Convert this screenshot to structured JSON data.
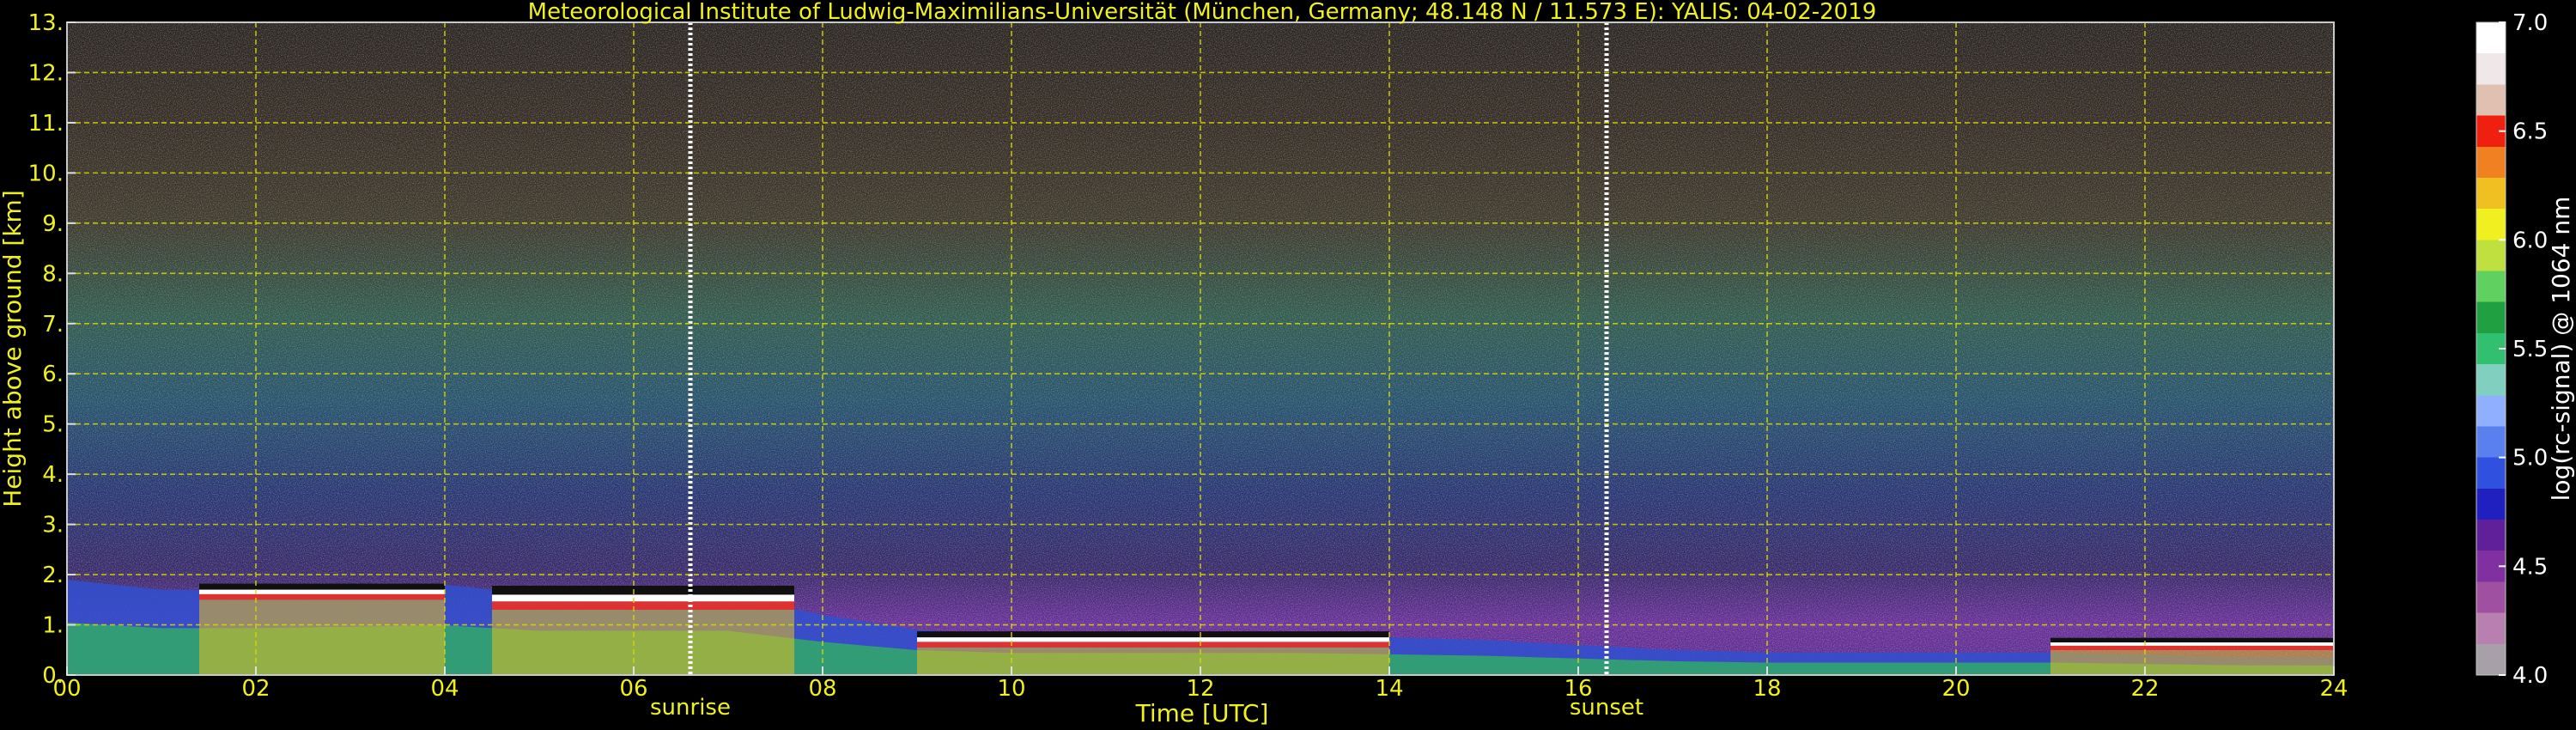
{
  "chart_data": {
    "type": "heatmap",
    "title": "Meteorological Institute of Ludwig-Maximilians-Universität (München, Germany; 48.148 N / 11.573 E):    YALIS: 04-02-2019",
    "xlabel": "Time [UTC]",
    "ylabel": "Height above ground [km]",
    "xlim": [
      0,
      24
    ],
    "ylim": [
      0,
      13
    ],
    "x_ticks": [
      0,
      2,
      4,
      6,
      8,
      10,
      12,
      14,
      16,
      18,
      20,
      22,
      24
    ],
    "x_tick_labels": [
      "00",
      "02",
      "04",
      "06",
      "08",
      "10",
      "12",
      "14",
      "16",
      "18",
      "20",
      "22",
      "24"
    ],
    "y_ticks": [
      0,
      1,
      2,
      3,
      4,
      5,
      6,
      7,
      8,
      9,
      10,
      11,
      12,
      13
    ],
    "y_tick_labels": [
      "0.",
      "1.",
      "2.",
      "3.",
      "4.",
      "5.",
      "6.",
      "7.",
      "8.",
      "9.",
      "10.",
      "11.",
      "12.",
      "13."
    ],
    "grid": true,
    "colorbar": {
      "label": "log(rc-signal) @ 1064 nm",
      "range": [
        4.0,
        7.0
      ],
      "ticks": [
        4.0,
        4.5,
        5.0,
        5.5,
        6.0,
        6.5,
        7.0
      ],
      "tick_labels": [
        "4.0",
        "4.5",
        "5.0",
        "5.5",
        "6.0",
        "6.5",
        "7.0"
      ],
      "colors": [
        "#a8a0a8",
        "#b880b0",
        "#a050a0",
        "#8030a0",
        "#60209a",
        "#2020c0",
        "#3050e0",
        "#5a80f0",
        "#90b0ff",
        "#80d0c0",
        "#30c070",
        "#20a040",
        "#60d060",
        "#c0e040",
        "#f0f020",
        "#f0c020",
        "#f08020",
        "#f02010",
        "#e0c0b0",
        "#f0e8e8",
        "#ffffff"
      ]
    },
    "annotations": [
      {
        "text": "sunrise",
        "x": 6.6
      },
      {
        "text": "sunset",
        "x": 16.3
      }
    ],
    "colors": {
      "text": "#f0f020",
      "grid": "#d8d800",
      "background": "#000000",
      "marker_line": "#ffffff"
    },
    "features": {
      "boundary_layer_top_km": [
        [
          0,
          1.9
        ],
        [
          1,
          1.7
        ],
        [
          2,
          1.7
        ],
        [
          3,
          1.75
        ],
        [
          4,
          1.8
        ],
        [
          5,
          1.6
        ],
        [
          6,
          1.6
        ],
        [
          7,
          1.6
        ],
        [
          8,
          1.2
        ],
        [
          9,
          0.9
        ],
        [
          10,
          0.8
        ],
        [
          11,
          0.8
        ],
        [
          12,
          0.8
        ],
        [
          13,
          0.8
        ],
        [
          14,
          0.75
        ],
        [
          15,
          0.7
        ],
        [
          16,
          0.6
        ],
        [
          17,
          0.5
        ],
        [
          18,
          0.45
        ],
        [
          19,
          0.45
        ],
        [
          20,
          0.45
        ],
        [
          21,
          0.45
        ],
        [
          22,
          0.4
        ],
        [
          23,
          0.35
        ],
        [
          24,
          0.35
        ]
      ],
      "cloud_layers": [
        {
          "x_start": 1.4,
          "x_end": 4.0,
          "base_km": 1.5,
          "top_km": 1.7
        },
        {
          "x_start": 4.5,
          "x_end": 7.7,
          "base_km": 1.3,
          "top_km": 1.6
        },
        {
          "x_start": 9.0,
          "x_end": 14.0,
          "base_km": 0.55,
          "top_km": 0.75
        },
        {
          "x_start": 21.0,
          "x_end": 24.0,
          "base_km": 0.5,
          "top_km": 0.65
        }
      ]
    }
  }
}
